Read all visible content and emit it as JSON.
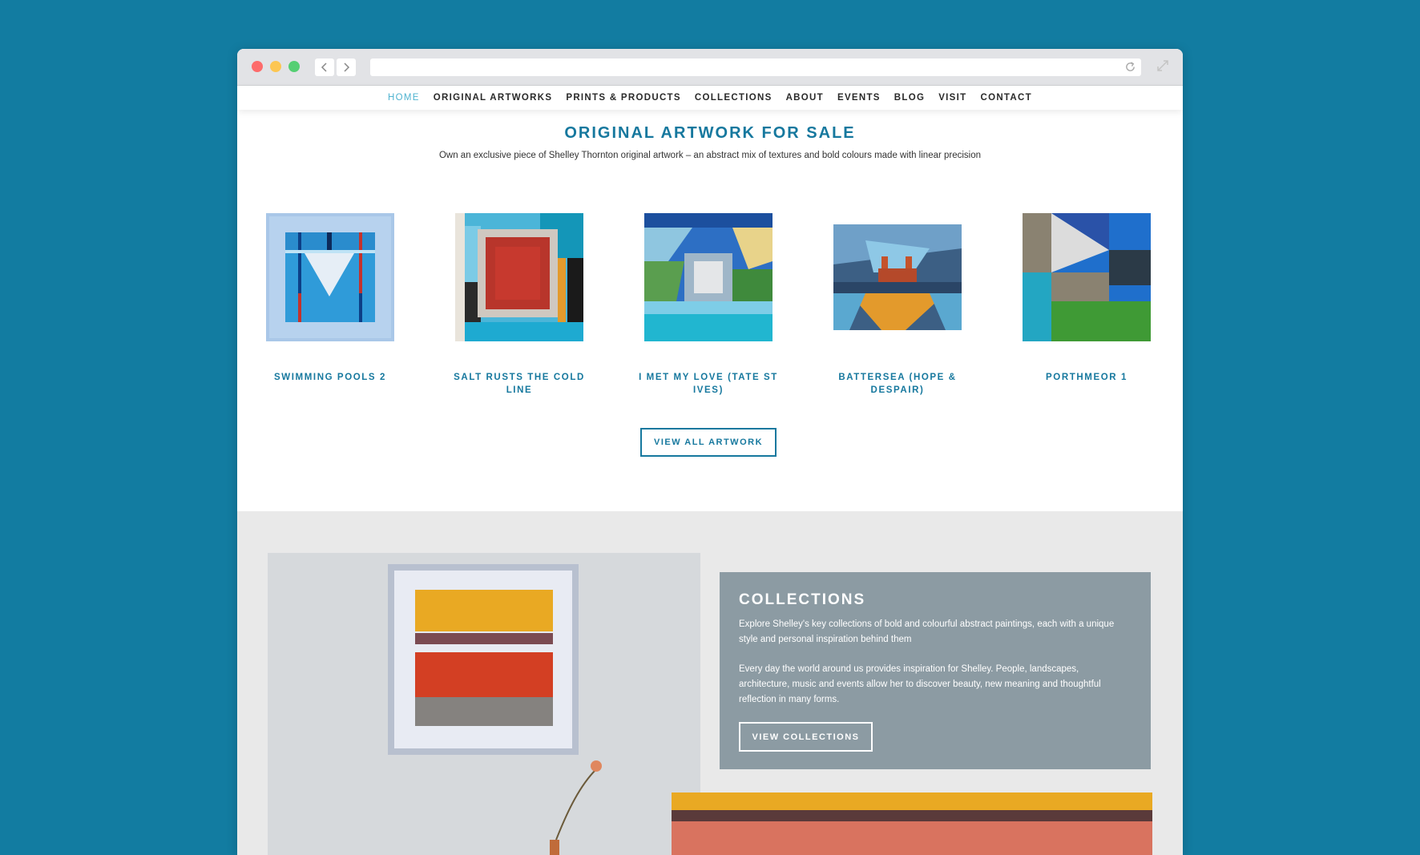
{
  "nav": {
    "items": [
      {
        "label": "HOME",
        "active": true
      },
      {
        "label": "ORIGINAL ARTWORKS"
      },
      {
        "label": "PRINTS & PRODUCTS"
      },
      {
        "label": "COLLECTIONS"
      },
      {
        "label": "ABOUT"
      },
      {
        "label": "EVENTS"
      },
      {
        "label": "BLOG"
      },
      {
        "label": "VISIT"
      },
      {
        "label": "CONTACT"
      }
    ]
  },
  "section": {
    "title": "ORIGINAL ARTWORK FOR SALE",
    "subtitle": "Own an exclusive piece of Shelley Thornton original artwork – an abstract mix of textures and bold colours made with linear precision"
  },
  "artworks": [
    {
      "title": "SWIMMING POOLS 2"
    },
    {
      "title": "SALT RUSTS THE COLD LINE"
    },
    {
      "title": "I MET MY LOVE (TATE ST IVES)"
    },
    {
      "title": "BATTERSEA (HOPE & DESPAIR)"
    },
    {
      "title": "PORTHMEOR 1"
    }
  ],
  "view_all_label": "VIEW ALL ARTWORK",
  "collections": {
    "title": "COLLECTIONS",
    "para1": "Explore Shelley's key collections of bold and colourful abstract paintings, each with a unique style and personal inspiration behind them",
    "para2": "Every day the world around us provides inspiration for Shelley. People, landscapes, architecture, music and events allow her to discover beauty, new meaning and thoughtful reflection in many forms.",
    "button_label": "VIEW COLLECTIONS"
  },
  "colors": {
    "page_bg": "#127ca1",
    "accent": "#16789e",
    "active_nav": "#4fb3d0",
    "collections_box": "#8c9ba3"
  }
}
